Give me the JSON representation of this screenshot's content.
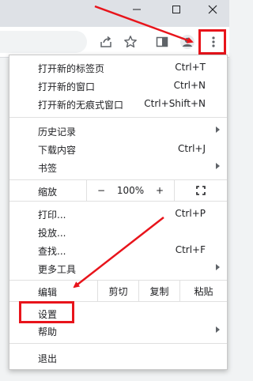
{
  "window": {
    "minimize_icon": "minimize-icon",
    "maximize_icon": "maximize-icon",
    "close_icon": "close-icon"
  },
  "toolbar": {
    "icons": [
      "share-icon",
      "star-icon",
      "side-panel-icon",
      "profile-icon",
      "more-vert-icon"
    ]
  },
  "menu": {
    "new_tab": {
      "label": "打开新的标签页",
      "shortcut": "Ctrl+T"
    },
    "new_window": {
      "label": "打开新的窗口",
      "shortcut": "Ctrl+N"
    },
    "new_incognito": {
      "label": "打开新的无痕式窗口",
      "shortcut": "Ctrl+Shift+N"
    },
    "history": {
      "label": "历史记录"
    },
    "downloads": {
      "label": "下载内容",
      "shortcut": "Ctrl+J"
    },
    "bookmarks": {
      "label": "书签"
    },
    "zoom": {
      "label": "缩放",
      "minus": "−",
      "value": "100%",
      "plus": "+"
    },
    "print": {
      "label": "打印...",
      "shortcut": "Ctrl+P"
    },
    "cast": {
      "label": "投放..."
    },
    "find": {
      "label": "查找...",
      "shortcut": "Ctrl+F"
    },
    "more_tools": {
      "label": "更多工具"
    },
    "edit": {
      "label": "编辑",
      "cut": "剪切",
      "copy": "复制",
      "paste": "粘贴"
    },
    "settings": {
      "label": "设置"
    },
    "help": {
      "label": "帮助"
    },
    "exit": {
      "label": "退出"
    }
  },
  "annotation_color": "#e8141b"
}
